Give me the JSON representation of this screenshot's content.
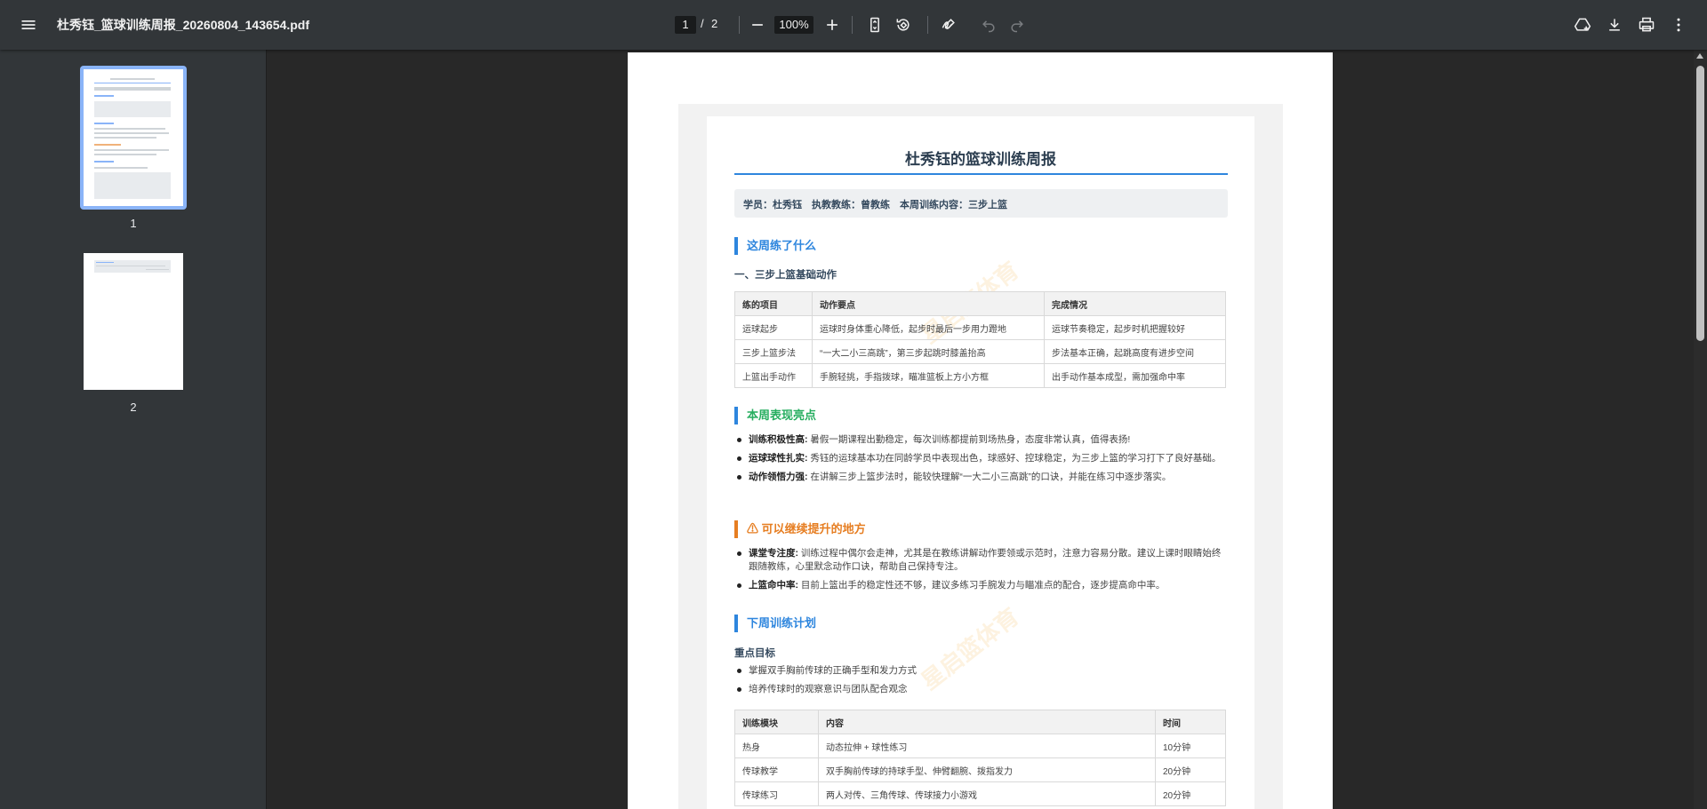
{
  "toolbar": {
    "title": "杜秀钰_篮球训练周报_20260804_143654.pdf",
    "current_page": "1",
    "page_separator": "/",
    "total_pages": "2",
    "zoom": "100%"
  },
  "sidebar": {
    "thumbnails": [
      {
        "label": "1",
        "active": true
      },
      {
        "label": "2",
        "active": false
      }
    ]
  },
  "report": {
    "title": "杜秀钰的篮球训练周报",
    "info": "学员：杜秀钰　执教教练：曾教练　本周训练内容：三步上篮",
    "sections": {
      "practice": {
        "heading": "这周练了什么",
        "sub": "一、三步上篮基础动作",
        "columns": [
          "练的项目",
          "动作要点",
          "完成情况"
        ],
        "rows": [
          [
            "运球起步",
            "运球时身体重心降低，起步时最后一步用力蹬地",
            "运球节奏稳定，起步时机把握较好"
          ],
          [
            "三步上篮步法",
            "“一大二小三高跳”，第三步起跳时膝盖抬高",
            "步法基本正确，起跳高度有进步空间"
          ],
          [
            "上篮出手动作",
            "手腕轻挑，手指拨球，瞄准篮板上方小方框",
            "出手动作基本成型，需加强命中率"
          ]
        ]
      },
      "highlights": {
        "heading": "本周表现亮点",
        "items": [
          {
            "label": "训练积极性高:",
            "text": "暑假一期课程出勤稳定，每次训练都提前到场热身，态度非常认真，值得表扬!"
          },
          {
            "label": "运球球性扎实:",
            "text": "秀钰的运球基本功在同龄学员中表现出色，球感好、控球稳定，为三步上篮的学习打下了良好基础。"
          },
          {
            "label": "动作领悟力强:",
            "text": "在讲解三步上篮步法时，能较快理解“一大二小三高跳”的口诀，并能在练习中逐步落实。"
          }
        ]
      },
      "improve": {
        "heading": "⚠ 可以继续提升的地方",
        "items": [
          {
            "label": "课堂专注度:",
            "text": "训练过程中偶尔会走神，尤其是在教练讲解动作要领或示范时，注意力容易分散。建议上课时眼睛始终跟随教练，心里默念动作口诀，帮助自己保持专注。"
          },
          {
            "label": "上篮命中率:",
            "text": "目前上篮出手的稳定性还不够，建议多练习手腕发力与瞄准点的配合，逐步提高命中率。"
          }
        ]
      },
      "plan": {
        "heading": "下周训练计划",
        "sub": "重点目标",
        "goals": [
          "掌握双手胸前传球的正确手型和发力方式",
          "培养传球时的观察意识与团队配合观念"
        ],
        "columns": [
          "训练模块",
          "内容",
          "时间"
        ],
        "rows": [
          [
            "热身",
            "动态拉伸 + 球性练习",
            "10分钟"
          ],
          [
            "传球教学",
            "双手胸前传球的持球手型、伸臂翻腕、拨指发力",
            "20分钟"
          ],
          [
            "传球练习",
            "两人对传、三角传球、传球接力小游戏",
            "20分钟"
          ]
        ]
      }
    },
    "watermark": "星启篮体育"
  }
}
